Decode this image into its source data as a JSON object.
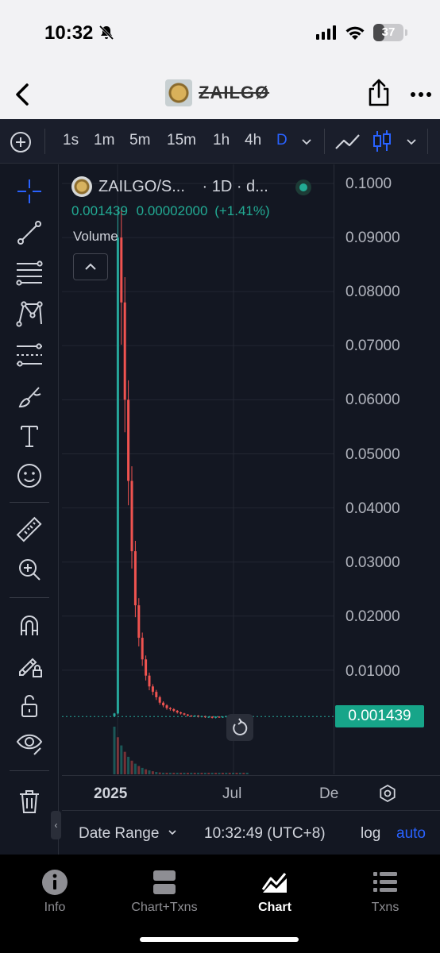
{
  "status_bar": {
    "time": "10:32",
    "battery": "37",
    "battery_level": 0.37,
    "icons": [
      "bell-slash-icon",
      "cellular-signal-icon",
      "wifi-icon",
      "battery-icon"
    ]
  },
  "nav": {
    "title": "ZAILGØ",
    "icons": [
      "chevron-left-icon",
      "share-icon",
      "more-icon"
    ]
  },
  "toolbar": {
    "timeframes": [
      "1s",
      "1m",
      "5m",
      "15m",
      "1h",
      "4h",
      "D"
    ],
    "active_timeframe": "D",
    "icons": [
      "add-circle-icon",
      "chevron-down-icon",
      "line-chart-icon",
      "candlestick-icon",
      "chevron-down-icon"
    ]
  },
  "sidebar": {
    "tools": [
      "crosshair-icon",
      "trend-line-icon",
      "fib-retracement-icon",
      "pattern-icon",
      "prediction-icon",
      "brush-icon",
      "text-icon",
      "emoji-icon",
      "ruler-icon",
      "zoom-in-icon",
      "magnet-icon",
      "lock-drawing-icon",
      "unlock-icon",
      "eye-icon",
      "trash-icon"
    ]
  },
  "legend": {
    "symbol": "ZAILGO/S...",
    "interval": "· 1D · d...",
    "last": "0.001439",
    "change": "0.00002000",
    "change_pct": "(+1.41%)",
    "volume_label": "Volume"
  },
  "price_axis": {
    "ticks": [
      "0.1000",
      "0.09000",
      "0.08000",
      "0.07000",
      "0.06000",
      "0.05000",
      "0.04000",
      "0.03000",
      "0.02000",
      "0.01000"
    ],
    "last_price_label": "0.001439"
  },
  "time_axis": {
    "labels": [
      "2025",
      "Jul",
      "De"
    ]
  },
  "bottom_bar": {
    "date_range": "Date Range",
    "clock": "10:32:49 (UTC+8)",
    "log": "log",
    "auto": "auto"
  },
  "tabs": [
    {
      "label": "Info",
      "icon": "info-icon"
    },
    {
      "label": "Chart+Txns",
      "icon": "split-view-icon"
    },
    {
      "label": "Chart",
      "icon": "chart-icon",
      "active": true
    },
    {
      "label": "Txns",
      "icon": "list-icon"
    }
  ],
  "chart_data": {
    "type": "candlestick",
    "ylim": [
      0,
      0.1
    ],
    "x_labels": [
      "2025",
      "Jul",
      "De"
    ],
    "y_ticks": [
      0.1,
      0.09,
      0.08,
      0.07,
      0.06,
      0.05,
      0.04,
      0.03,
      0.02,
      0.01
    ],
    "last_price": 0.001439,
    "close_series": [
      0.002,
      0.09,
      0.078,
      0.06,
      0.045,
      0.032,
      0.022,
      0.016,
      0.012,
      0.009,
      0.007,
      0.006,
      0.005,
      0.004,
      0.0035,
      0.003,
      0.0028,
      0.0025,
      0.0022,
      0.002,
      0.0018,
      0.0016,
      0.0015,
      0.0016,
      0.0014,
      0.0015,
      0.0013,
      0.0014,
      0.0012,
      0.0014,
      0.0013,
      0.0014,
      0.0015,
      0.0014,
      0.0016,
      0.0014,
      0.0015,
      0.0014,
      0.001439
    ],
    "grid": true,
    "colors": {
      "up": "#26a69a",
      "down": "#ef5350",
      "accent": "#2962ff",
      "last_price_bg": "#17a589"
    }
  }
}
